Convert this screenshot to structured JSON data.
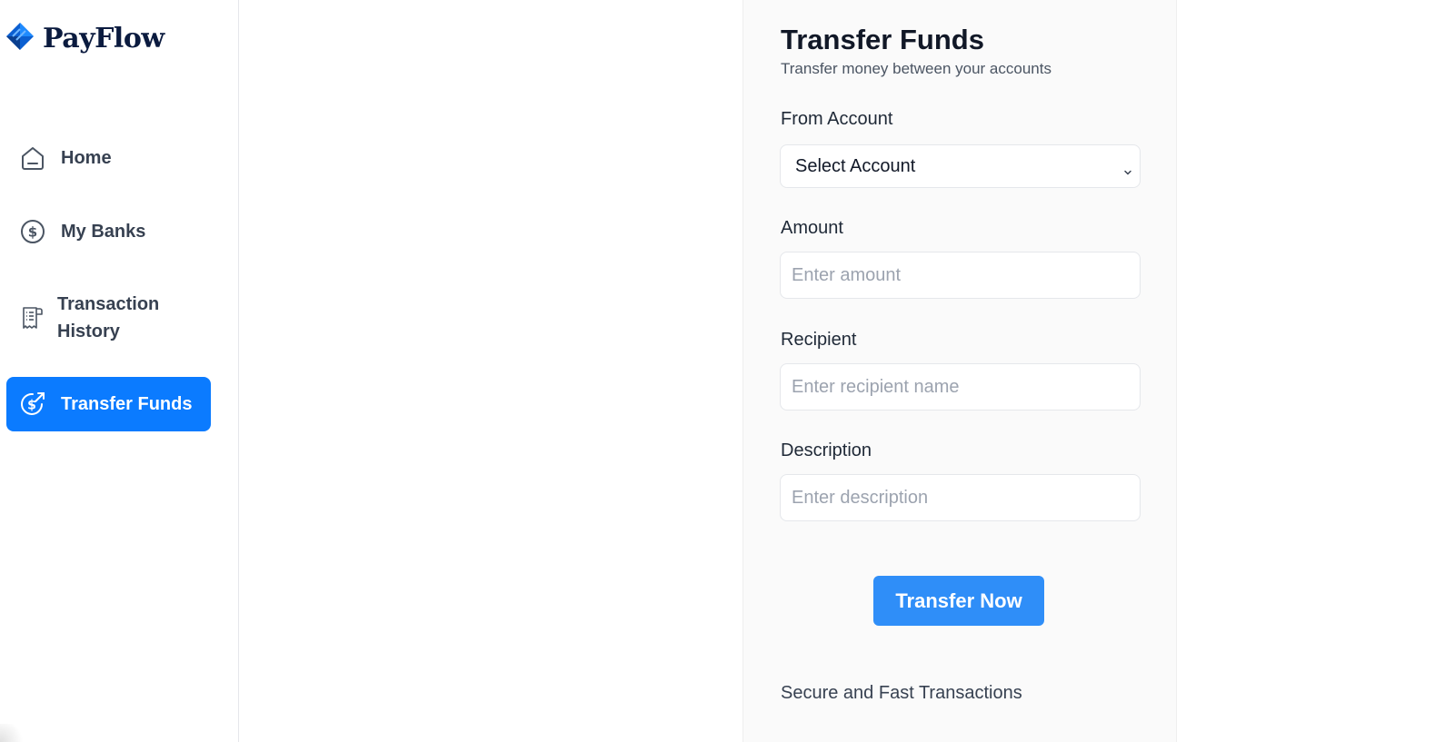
{
  "brand": {
    "name": "PayFlow",
    "logo_icon": "diamond-logo-icon"
  },
  "sidebar": {
    "items": [
      {
        "label": "Home",
        "icon": "home-icon"
      },
      {
        "label": "My Banks",
        "icon": "dollar-circle-icon"
      },
      {
        "label": "Transaction History",
        "icon": "receipt-icon"
      },
      {
        "label": "Transfer Funds",
        "icon": "transfer-dollar-icon",
        "active": true
      }
    ]
  },
  "form": {
    "title": "Transfer Funds",
    "subtitle": "Transfer money between your accounts",
    "from_account": {
      "label": "From Account",
      "value": "Select Account"
    },
    "amount": {
      "label": "Amount",
      "placeholder": "Enter amount"
    },
    "recipient": {
      "label": "Recipient",
      "placeholder": "Enter recipient name"
    },
    "description": {
      "label": "Description",
      "placeholder": "Enter description"
    },
    "submit_label": "Transfer Now",
    "footer_note": "Secure and Fast Transactions"
  },
  "colors": {
    "accent": "#0b7bff",
    "button": "#2f8ef8",
    "brand_text": "#0b1b3f"
  }
}
